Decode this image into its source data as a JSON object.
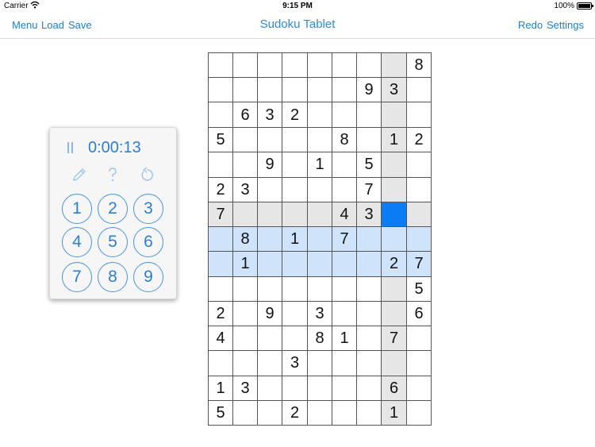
{
  "status_bar": {
    "carrier": "Carrier",
    "time": "9:15 PM",
    "battery": "100%"
  },
  "nav": {
    "left_buttons": [
      "Menu",
      "Load",
      "Save"
    ],
    "title": "Sudoku Tablet",
    "right_buttons": [
      "Redo",
      "Settings"
    ]
  },
  "panel": {
    "timer": "0:00:13",
    "tools": [
      "pencil-icon",
      "help-icon",
      "undo-icon"
    ],
    "numpad": [
      "1",
      "2",
      "3",
      "4",
      "5",
      "6",
      "7",
      "8",
      "9"
    ]
  },
  "colors": {
    "accent": "#2a7fd0",
    "highlight_row": "#cfe3fb",
    "highlight_col": "#e6e6e6",
    "selected": "#0b7cf4"
  },
  "board": {
    "rows": [
      [
        "",
        "",
        "",
        "",
        "",
        "",
        "",
        "",
        "8"
      ],
      [
        "",
        "",
        "",
        "",
        "",
        "",
        "9",
        "3",
        ""
      ],
      [
        "",
        "6",
        "3",
        "2",
        "",
        "",
        "",
        "",
        ""
      ],
      [
        "5",
        "",
        "",
        "",
        "",
        "8",
        "",
        "1",
        "2"
      ],
      [
        "",
        "",
        "9",
        "",
        "1",
        "",
        "5",
        "",
        ""
      ],
      [
        "2",
        "3",
        "",
        "",
        "",
        "",
        "7",
        "",
        ""
      ],
      [
        "7",
        "",
        "",
        "",
        "",
        "4",
        "3",
        "",
        ""
      ],
      [
        "",
        "8",
        "",
        "1",
        "",
        "7",
        "",
        "",
        ""
      ],
      [
        "",
        "1",
        "",
        "",
        "",
        "",
        "",
        "2",
        "7"
      ],
      [
        "",
        "",
        "",
        "",
        "",
        "",
        "",
        "",
        "5"
      ],
      [
        "2",
        "",
        "9",
        "",
        "3",
        "",
        "",
        "",
        "6"
      ],
      [
        "4",
        "",
        "",
        "",
        "8",
        "1",
        "",
        "7",
        ""
      ],
      [
        "",
        "",
        "",
        "3",
        "",
        "",
        "",
        "",
        ""
      ],
      [
        "1",
        "3",
        "",
        "",
        "",
        "",
        "",
        "6",
        ""
      ],
      [
        "5",
        "",
        "",
        "2",
        "",
        "",
        "",
        "1",
        ""
      ]
    ],
    "selected": {
      "row": 6,
      "col": 7
    }
  }
}
